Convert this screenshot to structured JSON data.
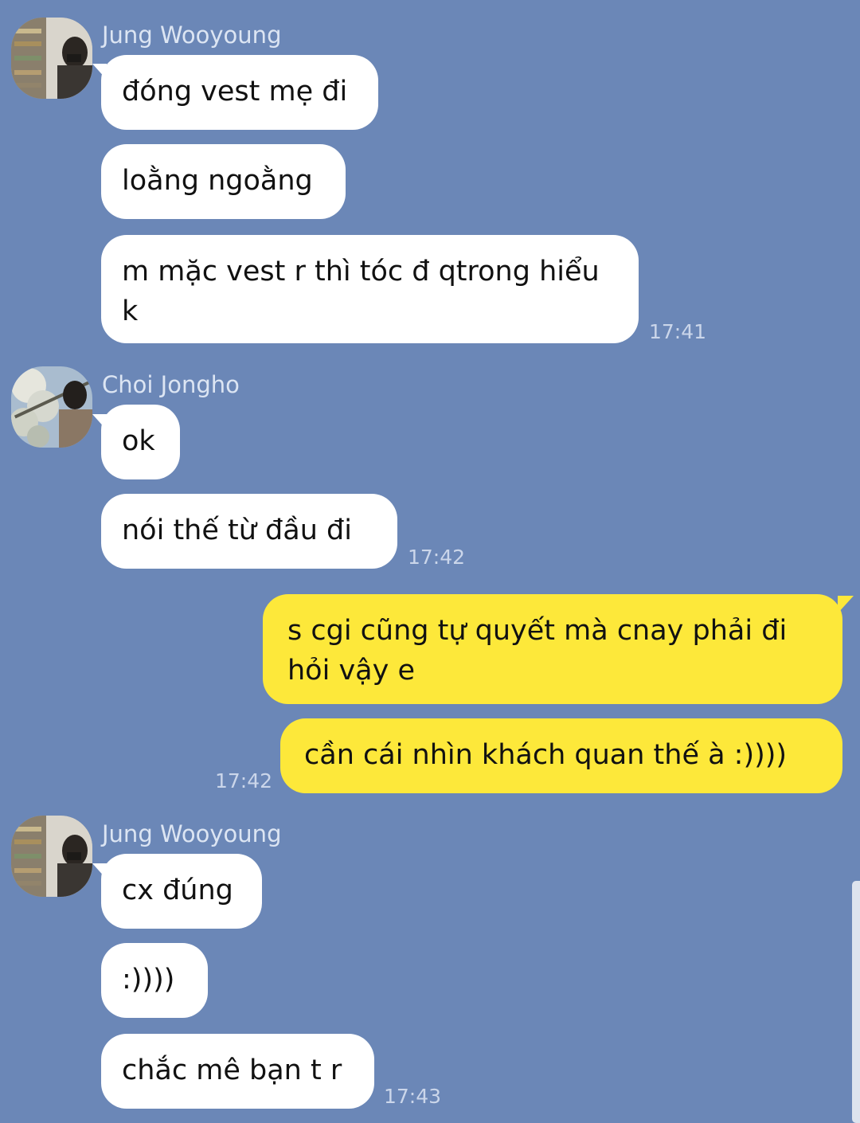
{
  "groups": [
    {
      "sender": "Jung Wooyoung",
      "avatar": "profile-photo-jung-wooyoung",
      "messages": [
        {
          "text": "đóng vest mẹ đi"
        },
        {
          "text": "loằng ngoằng"
        },
        {
          "text": "m mặc vest r thì tóc đ qtrong hiểu k"
        }
      ],
      "time": "17:41"
    },
    {
      "sender": "Choi Jongho",
      "avatar": "profile-photo-choi-jongho",
      "messages": [
        {
          "text": "ok"
        },
        {
          "text": "nói thế từ đầu đi"
        }
      ],
      "time": "17:42"
    },
    {
      "sender": "me",
      "messages": [
        {
          "text": "s cgi cũng tự quyết mà cnay phải đi hỏi vậy e"
        },
        {
          "text": "cần cái nhìn khách quan thế à :))))"
        }
      ],
      "time": "17:42"
    },
    {
      "sender": "Jung Wooyoung",
      "avatar": "profile-photo-jung-wooyoung",
      "messages": [
        {
          "text": "cx đúng"
        },
        {
          "text": ":))))"
        },
        {
          "text": "chắc mê bạn t r"
        }
      ],
      "time": "17:43"
    }
  ],
  "colors": {
    "background": "#6b87b7",
    "incoming_bubble": "#ffffff",
    "outgoing_bubble": "#fde83a"
  }
}
